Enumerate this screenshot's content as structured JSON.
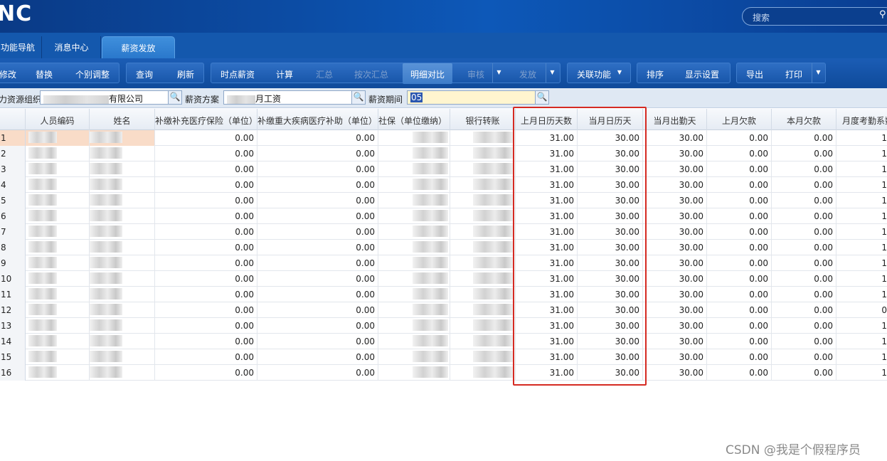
{
  "app": {
    "logo_text": "NC",
    "search_placeholder": "搜索"
  },
  "tabs": [
    {
      "label": "功能导航"
    },
    {
      "label": "消息中心"
    },
    {
      "label": "薪资发放",
      "active": true
    }
  ],
  "toolbar": {
    "modify": "修改",
    "replace": "替换",
    "individual_adjust": "个别调整",
    "query": "查询",
    "refresh": "刷新",
    "hourly_salary": "时点薪资",
    "calculate": "计算",
    "summary": "汇总",
    "summary_by_times": "按次汇总",
    "detail_compare": "明细对比",
    "audit": "审核",
    "release": "发放",
    "linked_functions": "关联功能",
    "sort": "排序",
    "display_settings": "显示设置",
    "export": "导出",
    "print": "打印"
  },
  "filters": {
    "org_label": "力资源组织",
    "org_value": "有限公司",
    "plan_label": "薪资方案",
    "plan_value": "月工资",
    "period_label": "薪资期间",
    "period_value": "05"
  },
  "table": {
    "columns": [
      "人员编码",
      "姓名",
      "补缴补充医疗保险（单位）",
      "补缴重大疾病医疗补助（单位）",
      "社保（单位缴纳）",
      "银行转账",
      "上月日历天数",
      "当月日历天",
      "当月出勤天",
      "上月欠款",
      "本月欠款",
      "月度考勤系数"
    ],
    "rows": [
      {
        "n": "1",
        "a": "0.00",
        "b": "0.00",
        "prev_days": "31.00",
        "cur_days": "30.00",
        "att": "30.00",
        "prev_owe": "0.00",
        "cur_owe": "0.00",
        "coef": "1"
      },
      {
        "n": "2",
        "a": "0.00",
        "b": "0.00",
        "prev_days": "31.00",
        "cur_days": "30.00",
        "att": "30.00",
        "prev_owe": "0.00",
        "cur_owe": "0.00",
        "coef": "1"
      },
      {
        "n": "3",
        "a": "0.00",
        "b": "0.00",
        "prev_days": "31.00",
        "cur_days": "30.00",
        "att": "30.00",
        "prev_owe": "0.00",
        "cur_owe": "0.00",
        "coef": "1"
      },
      {
        "n": "4",
        "a": "0.00",
        "b": "0.00",
        "prev_days": "31.00",
        "cur_days": "30.00",
        "att": "30.00",
        "prev_owe": "0.00",
        "cur_owe": "0.00",
        "coef": "1"
      },
      {
        "n": "5",
        "a": "0.00",
        "b": "0.00",
        "prev_days": "31.00",
        "cur_days": "30.00",
        "att": "30.00",
        "prev_owe": "0.00",
        "cur_owe": "0.00",
        "coef": "1"
      },
      {
        "n": "6",
        "a": "0.00",
        "b": "0.00",
        "prev_days": "31.00",
        "cur_days": "30.00",
        "att": "30.00",
        "prev_owe": "0.00",
        "cur_owe": "0.00",
        "coef": "1"
      },
      {
        "n": "7",
        "a": "0.00",
        "b": "0.00",
        "prev_days": "31.00",
        "cur_days": "30.00",
        "att": "30.00",
        "prev_owe": "0.00",
        "cur_owe": "0.00",
        "coef": "1"
      },
      {
        "n": "8",
        "a": "0.00",
        "b": "0.00",
        "prev_days": "31.00",
        "cur_days": "30.00",
        "att": "30.00",
        "prev_owe": "0.00",
        "cur_owe": "0.00",
        "coef": "1"
      },
      {
        "n": "9",
        "a": "0.00",
        "b": "0.00",
        "prev_days": "31.00",
        "cur_days": "30.00",
        "att": "30.00",
        "prev_owe": "0.00",
        "cur_owe": "0.00",
        "coef": "1"
      },
      {
        "n": "10",
        "a": "0.00",
        "b": "0.00",
        "prev_days": "31.00",
        "cur_days": "30.00",
        "att": "30.00",
        "prev_owe": "0.00",
        "cur_owe": "0.00",
        "coef": "1"
      },
      {
        "n": "11",
        "a": "0.00",
        "b": "0.00",
        "prev_days": "31.00",
        "cur_days": "30.00",
        "att": "30.00",
        "prev_owe": "0.00",
        "cur_owe": "0.00",
        "coef": "1"
      },
      {
        "n": "12",
        "a": "0.00",
        "b": "0.00",
        "prev_days": "31.00",
        "cur_days": "30.00",
        "att": "30.00",
        "prev_owe": "0.00",
        "cur_owe": "0.00",
        "coef": "0"
      },
      {
        "n": "13",
        "a": "0.00",
        "b": "0.00",
        "prev_days": "31.00",
        "cur_days": "30.00",
        "att": "30.00",
        "prev_owe": "0.00",
        "cur_owe": "0.00",
        "coef": "1"
      },
      {
        "n": "14",
        "a": "0.00",
        "b": "0.00",
        "prev_days": "31.00",
        "cur_days": "30.00",
        "att": "30.00",
        "prev_owe": "0.00",
        "cur_owe": "0.00",
        "coef": "1"
      },
      {
        "n": "15",
        "a": "0.00",
        "b": "0.00",
        "prev_days": "31.00",
        "cur_days": "30.00",
        "att": "30.00",
        "prev_owe": "0.00",
        "cur_owe": "0.00",
        "coef": "1"
      },
      {
        "n": "16",
        "a": "0.00",
        "b": "0.00",
        "prev_days": "31.00",
        "cur_days": "30.00",
        "att": "30.00",
        "prev_owe": "0.00",
        "cur_owe": "0.00",
        "coef": "1"
      }
    ]
  },
  "watermark": "CSDN @我是个假程序员",
  "colors": {
    "highlight_box": "#d52a22",
    "selected_row": "#f9dcc8",
    "toolbar": "#1458ad"
  }
}
